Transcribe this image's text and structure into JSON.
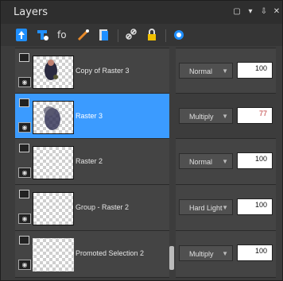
{
  "panel": {
    "title": "Layers"
  },
  "titlebar_buttons": [
    "square-icon",
    "chevron-down-icon",
    "pin-icon",
    "close-icon"
  ],
  "toolbar": [
    "new-raster-layer-icon",
    "new-vector-layer-icon",
    "new-mask-layer-icon",
    "new-adjustment-layer-icon",
    "duplicate-layer-icon",
    "link-icon",
    "lock-icon",
    "layer-visibility-icon"
  ],
  "layers": [
    {
      "name": "Copy of Raster 3",
      "blend": "Normal",
      "opacity": "100",
      "selected": false
    },
    {
      "name": "Raster 3",
      "blend": "Multiply",
      "opacity": "77",
      "selected": true
    },
    {
      "name": "Raster 2",
      "blend": "Normal",
      "opacity": "100",
      "selected": false
    },
    {
      "name": "Group - Raster 2",
      "blend": "Hard Light",
      "opacity": "100",
      "selected": false
    },
    {
      "name": "Promoted Selection 2",
      "blend": "Multiply",
      "opacity": "100",
      "selected": false
    }
  ]
}
